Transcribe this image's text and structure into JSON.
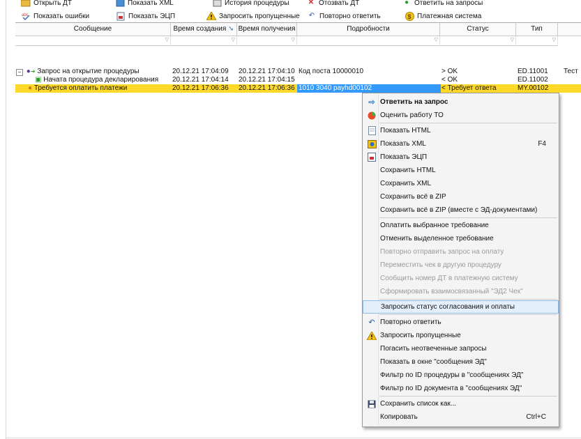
{
  "toolbar_row1": [
    {
      "name": "open-dt-button",
      "label": "Открыть ДТ",
      "icon": "folder-icon"
    },
    {
      "name": "show-xml-top-button",
      "label": "Показать XML",
      "icon": "xml-icon"
    },
    {
      "name": "procedure-history-button",
      "label": "История процедуры",
      "icon": "history-icon"
    },
    {
      "name": "withdraw-dt-button",
      "label": "Отозвать ДТ",
      "icon": "cross-icon"
    },
    {
      "name": "answer-requests-button",
      "label": "Ответить на запросы",
      "icon": "check-icon"
    }
  ],
  "toolbar_row2": [
    {
      "name": "show-errors-button",
      "label": "Показать ошибки",
      "icon": "error-icon"
    },
    {
      "name": "show-ecp-button",
      "label": "Показать ЭЦП",
      "icon": "signature-icon"
    },
    {
      "name": "request-missing-button",
      "label": "Запросить пропущенные",
      "icon": "warning-icon"
    },
    {
      "name": "repeat-answer-button",
      "label": "Повторно ответить",
      "icon": "undo-icon"
    },
    {
      "name": "payment-system-button",
      "label": "Платежная система",
      "icon": "dollar-coin-icon"
    }
  ],
  "columns": [
    {
      "key": "message",
      "label": "Сообщение"
    },
    {
      "key": "created",
      "label": "Время создания"
    },
    {
      "key": "received",
      "label": "Время получения"
    },
    {
      "key": "details",
      "label": "Подробности"
    },
    {
      "key": "status",
      "label": "Статус"
    },
    {
      "key": "type",
      "label": "Тип"
    }
  ],
  "rows": [
    {
      "message": "Запрос на открытие процедуры",
      "created": "20.12.21 17:04:09",
      "received": "20.12.21 17:04:10",
      "details": "Код поста 10000010",
      "status": "> OK",
      "type": "ED.11001",
      "extra": "Тест"
    },
    {
      "message": "Начата процедура декларирования",
      "created": "20.12.21 17:04:14",
      "received": "20.12.21 17:04:15",
      "details": "",
      "status": "< OK",
      "type": "ED.11002",
      "extra": ""
    },
    {
      "message": "Требуется оплатить платежи",
      "created": "20.12.21 17:06:36",
      "received": "20.12.21 17:06:36",
      "details": "1010 3040 payhd00102",
      "status": "< Требует ответа",
      "type": "MY.00102",
      "extra": ""
    }
  ],
  "context_menu": [
    {
      "name": "menu-answer-request",
      "label": "Ответить на запрос",
      "icon": "arrow-right-icon",
      "bold": true
    },
    {
      "name": "menu-rate-to",
      "label": "Оценить работу ТО",
      "icon": "rating-circle-icon"
    },
    {
      "sep": true
    },
    {
      "name": "menu-show-html",
      "label": "Показать HTML",
      "icon": "html-page-icon"
    },
    {
      "name": "menu-show-xml",
      "label": "Показать XML",
      "icon": "xml-icon",
      "shortcut": "F4"
    },
    {
      "name": "menu-show-ecp",
      "label": "Показать ЭЦП",
      "icon": "signature-icon"
    },
    {
      "name": "menu-save-html",
      "label": "Сохранить HTML"
    },
    {
      "name": "menu-save-xml",
      "label": "Сохранить XML"
    },
    {
      "name": "menu-save-zip",
      "label": "Сохранить всё в ZIP"
    },
    {
      "name": "menu-save-zip-with-docs",
      "label": "Сохранить всё в ZIP  (вместе с ЭД-документами)"
    },
    {
      "sep": true
    },
    {
      "name": "menu-pay-selected",
      "label": "Оплатить выбранное требование"
    },
    {
      "name": "menu-cancel-selected",
      "label": "Отменить выделенное требование"
    },
    {
      "name": "menu-resend-payment",
      "label": "Повторно отправить запрос на оплату",
      "disabled": true
    },
    {
      "name": "menu-move-check",
      "label": "Переместить чек в другую процедуру",
      "disabled": true
    },
    {
      "name": "menu-report-dt-number",
      "label": "Сообщить номер ДТ в платежную систему",
      "disabled": true
    },
    {
      "name": "menu-form-ed2",
      "label": "Сформировать взаимосвязанный \"ЭД2 Чек\"",
      "disabled": true
    },
    {
      "sep": true
    },
    {
      "name": "menu-request-status",
      "label": "Запросить статус согласования и оплаты",
      "highlight": true
    },
    {
      "sep": true
    },
    {
      "name": "menu-repeat-answer",
      "label": "Повторно ответить",
      "icon": "undo-icon"
    },
    {
      "name": "menu-request-missing",
      "label": "Запросить пропущенные",
      "icon": "warning-icon"
    },
    {
      "name": "menu-close-unanswered",
      "label": "Погасить неотвеченные запросы"
    },
    {
      "name": "menu-show-in-messages",
      "label": "Показать в окне \"сообщения ЭД\""
    },
    {
      "name": "menu-filter-procedure",
      "label": "Фильтр по ID процедуры в \"сообщениях ЭД\""
    },
    {
      "name": "menu-filter-document",
      "label": "Фильтр по ID документа в \"сообщениях ЭД\""
    },
    {
      "sep": true
    },
    {
      "name": "menu-save-list",
      "label": "Сохранить список как...",
      "icon": "floppy-icon"
    },
    {
      "name": "menu-copy",
      "label": "Копировать",
      "shortcut": "Ctrl+C"
    }
  ],
  "colors": {
    "highlight_row": "#ffd92a",
    "selection": "#3399ff",
    "menu_hover": "#e3effa"
  }
}
